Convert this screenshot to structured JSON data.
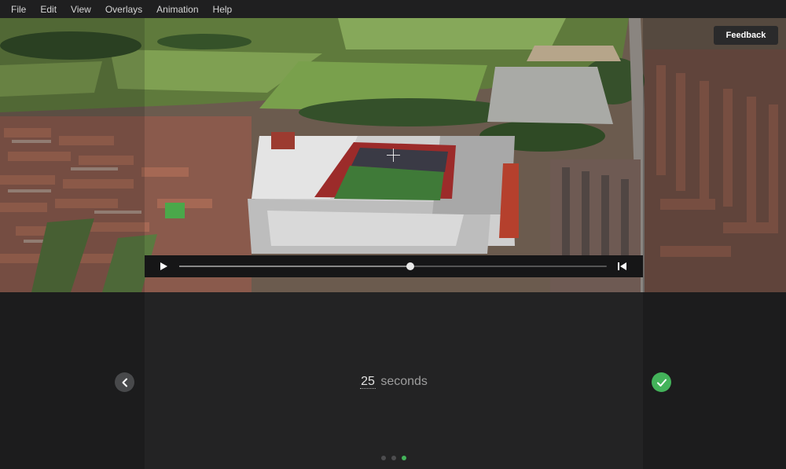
{
  "menu": {
    "items": [
      {
        "label": "File"
      },
      {
        "label": "Edit"
      },
      {
        "label": "View"
      },
      {
        "label": "Overlays"
      },
      {
        "label": "Animation"
      },
      {
        "label": "Help"
      }
    ]
  },
  "viewport": {
    "feedback_label": "Feedback"
  },
  "playback": {
    "progress": 0.54
  },
  "panel": {
    "duration_value": "25",
    "duration_unit": "seconds",
    "steps_total": 3,
    "steps_active": 3
  },
  "colors": {
    "accent": "#43b35a",
    "background": "#1c1c1d"
  },
  "icons": {
    "play": "play-icon",
    "skip_start": "skip-to-start-icon",
    "back": "chevron-left-icon",
    "confirm": "checkmark-icon"
  }
}
